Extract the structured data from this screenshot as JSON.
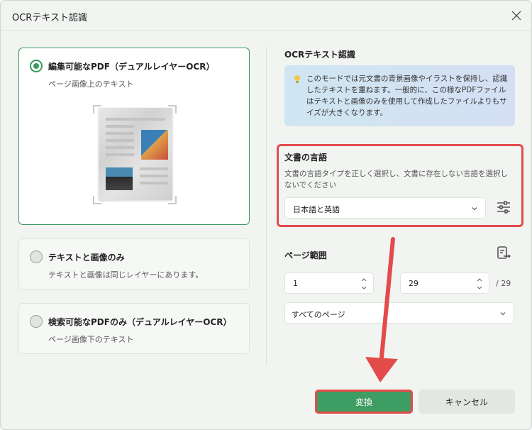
{
  "window": {
    "title": "OCRテキスト認識"
  },
  "options": [
    {
      "title": "編集可能なPDF（デュアルレイヤーOCR）",
      "subtitle": "ページ画像上のテキスト",
      "selected": true
    },
    {
      "title": "テキストと画像のみ",
      "subtitle": "テキストと画像は同じレイヤーにあります。",
      "selected": false
    },
    {
      "title": "検索可能なPDFのみ（デュアルレイヤーOCR）",
      "subtitle": "ページ画像下のテキスト",
      "selected": false
    }
  ],
  "ocr_section": {
    "title": "OCRテキスト認識",
    "info": "このモードでは元文書の背景画像やイラストを保持し、認識したテキストを重ねます。一般的に、この様なPDFファイルはテキストと画像のみを使用して作成したファイルよりもサイズが大きくなります。"
  },
  "language": {
    "title": "文書の言語",
    "description": "文書の言語タイプを正しく選択し、文書に存在しない言語を選択しないでください",
    "selected": "日本語と英語"
  },
  "page_range": {
    "title": "ページ範囲",
    "from": "1",
    "to": "29",
    "total": "/ 29",
    "scope": "すべてのページ"
  },
  "buttons": {
    "convert": "変換",
    "cancel": "キャンセル"
  },
  "colors": {
    "accent": "#3e9d63",
    "highlight": "#e34b4b"
  }
}
